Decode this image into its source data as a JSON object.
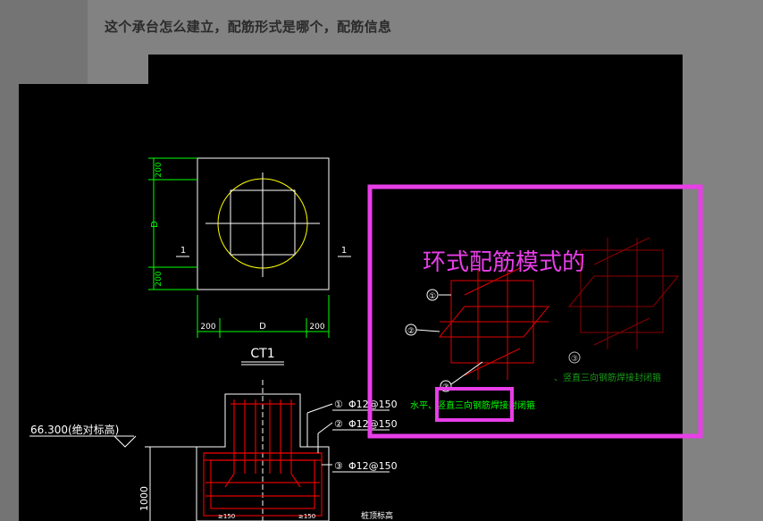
{
  "post": {
    "question": "这个承台怎么建立，配筋形式是哪个，配筋信息"
  },
  "drawing": {
    "plan_label_D": "D",
    "dim_200": "200",
    "section_mark": "1",
    "title": "CT1",
    "rebar_1_num": "①",
    "rebar_1_spec": "Φ12@150",
    "rebar_2_num": "②",
    "rebar_2_spec": "Φ12@150",
    "rebar_3_num": "③",
    "rebar_3_spec": "Φ12@150",
    "elevation": "66.300(绝对标高)",
    "depth": "1000",
    "rebar_mark_250": "≥150",
    "bottom_note": "桩顶标高",
    "detail_1": "①",
    "detail_2": "②",
    "detail_3": "③",
    "detail_note": "水平、竖直三向钢筋焊接封闭箍",
    "detail_note_right": "、竖直三向钢筋焊接封闭箍"
  },
  "annotation": {
    "label": "环式配筋模式的",
    "color": "#e83ee8"
  },
  "colors": {
    "cad_bg": "#000000",
    "white_line": "#ffffff",
    "dim_green": "#00ff00",
    "circle_yellow": "#ffff00",
    "rebar_red": "#e00000",
    "annotation_magenta": "#e83ee8"
  }
}
